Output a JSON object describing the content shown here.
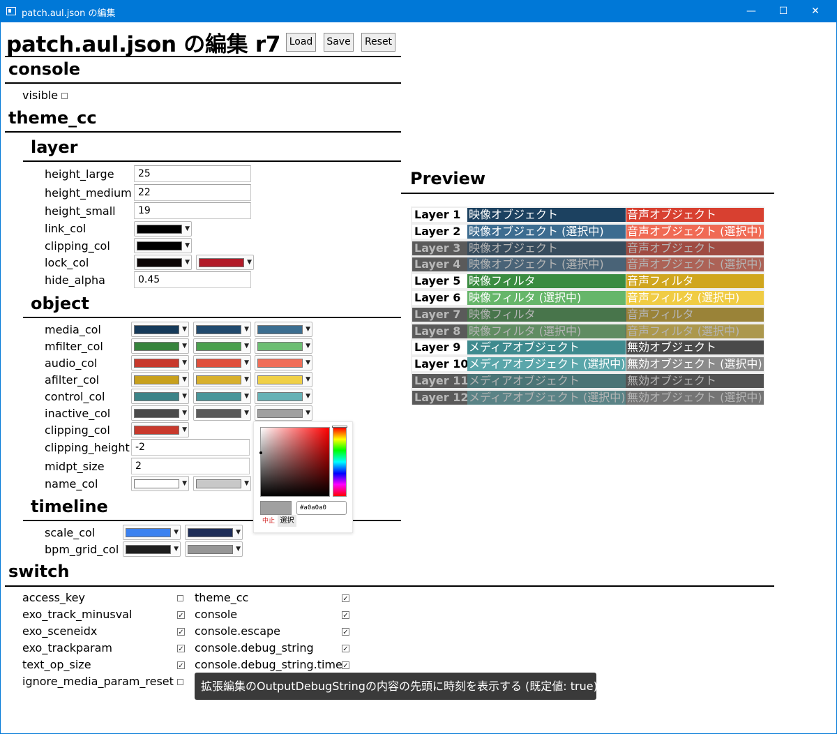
{
  "window": {
    "title": "patch.aul.json の編集",
    "min": "—",
    "max": "☐",
    "close": "✕"
  },
  "header": {
    "title": "patch.aul.json の編集 r7",
    "load": "Load",
    "save": "Save",
    "reset": "Reset"
  },
  "console": {
    "heading": "console",
    "visible_label": "visible",
    "visible_checked": false
  },
  "theme_cc": {
    "heading": "theme_cc",
    "layer": {
      "heading": "layer",
      "height_large": {
        "label": "height_large",
        "value": "25"
      },
      "height_medium": {
        "label": "height_medium",
        "value": "22"
      },
      "height_small": {
        "label": "height_small",
        "value": "19"
      },
      "link_col": {
        "label": "link_col",
        "colors": [
          "#000000"
        ]
      },
      "clipping_col": {
        "label": "clipping_col",
        "colors": [
          "#000000"
        ]
      },
      "lock_col": {
        "label": "lock_col",
        "colors": [
          "#0c0505",
          "#b21a28"
        ]
      },
      "hide_alpha": {
        "label": "hide_alpha",
        "value": "0.45"
      }
    },
    "object": {
      "heading": "object",
      "media_col": {
        "label": "media_col",
        "colors": [
          "#163a5a",
          "#214a6e",
          "#3c6e90"
        ]
      },
      "mfilter_col": {
        "label": "mfilter_col",
        "colors": [
          "#36843c",
          "#4aa04e",
          "#6cbe72"
        ]
      },
      "audio_col": {
        "label": "audio_col",
        "colors": [
          "#c8392c",
          "#e0503c",
          "#f06e58"
        ]
      },
      "afilter_col": {
        "label": "afilter_col",
        "colors": [
          "#c8a01c",
          "#d8b02c",
          "#f0d046"
        ]
      },
      "control_col": {
        "label": "control_col",
        "colors": [
          "#3c8488",
          "#48969a",
          "#66b2b6"
        ]
      },
      "inactive_col": {
        "label": "inactive_col",
        "colors": [
          "#4a4a4a",
          "#5a5a5a",
          "#a0a0a0"
        ]
      },
      "clipping_col": {
        "label": "clipping_col",
        "colors": [
          "#c8392c"
        ]
      },
      "clipping_height": {
        "label": "clipping_height",
        "value": "-2"
      },
      "midpt_size": {
        "label": "midpt_size",
        "value": "2"
      },
      "name_col": {
        "label": "name_col",
        "colors": [
          "#ffffff",
          "#c8c8c8"
        ]
      }
    },
    "timeline": {
      "heading": "timeline",
      "scale_col": {
        "label": "scale_col",
        "colors": [
          "#3c82f0",
          "#1e2d58"
        ]
      },
      "bpm_grid_col": {
        "label": "bpm_grid_col",
        "colors": [
          "#1e1e1e",
          "#969696"
        ]
      }
    }
  },
  "preview": {
    "heading": "Preview",
    "rows": [
      {
        "layer": "Layer 1",
        "left": "映像オブジェクト",
        "right": "音声オブジェクト",
        "lay_bg": "#ffffff",
        "lay_fg": "#000000",
        "left_bg": "#1c4160",
        "right_bg": "#d84030",
        "dim": false
      },
      {
        "layer": "Layer 2",
        "left": "映像オブジェクト (選択中)",
        "right": "音声オブジェクト (選択中)",
        "lay_bg": "#ffffff",
        "lay_fg": "#000000",
        "left_bg": "#3c6c90",
        "right_bg": "#f06a54",
        "dim": false
      },
      {
        "layer": "Layer 3",
        "left": "映像オブジェクト",
        "right": "音声オブジェクト",
        "lay_bg": "#5a5a5a",
        "lay_fg": "#b8b8b8",
        "left_bg": "#1c4160",
        "right_bg": "#d84030",
        "dim": true
      },
      {
        "layer": "Layer 4",
        "left": "映像オブジェクト (選択中)",
        "right": "音声オブジェクト (選択中)",
        "lay_bg": "#5a5a5a",
        "lay_fg": "#b8b8b8",
        "left_bg": "#3c6c90",
        "right_bg": "#f06a54",
        "dim": true
      },
      {
        "layer": "Layer 5",
        "left": "映像フィルタ",
        "right": "音声フィルタ",
        "lay_bg": "#ffffff",
        "lay_fg": "#000000",
        "left_bg": "#3a8c40",
        "right_bg": "#d0a61e",
        "dim": false
      },
      {
        "layer": "Layer 6",
        "left": "映像フィルタ (選択中)",
        "right": "音声フィルタ (選択中)",
        "lay_bg": "#ffffff",
        "lay_fg": "#000000",
        "left_bg": "#66b66a",
        "right_bg": "#f0cc44",
        "dim": false
      },
      {
        "layer": "Layer 7",
        "left": "映像フィルタ",
        "right": "音声フィルタ",
        "lay_bg": "#5a5a5a",
        "lay_fg": "#b8b8b8",
        "left_bg": "#3a8c40",
        "right_bg": "#d0a61e",
        "dim": true
      },
      {
        "layer": "Layer 8",
        "left": "映像フィルタ (選択中)",
        "right": "音声フィルタ (選択中)",
        "lay_bg": "#5a5a5a",
        "lay_fg": "#b8b8b8",
        "left_bg": "#66b66a",
        "right_bg": "#f0cc44",
        "dim": true
      },
      {
        "layer": "Layer 9",
        "left": "メディアオブジェクト",
        "right": "無効オブジェクト",
        "lay_bg": "#ffffff",
        "lay_fg": "#000000",
        "left_bg": "#3e8a8e",
        "right_bg": "#4a4a4a",
        "dim": false
      },
      {
        "layer": "Layer 10",
        "left": "メディアオブジェクト (選択中)",
        "right": "無効オブジェクト (選択中)",
        "lay_bg": "#ffffff",
        "lay_fg": "#000000",
        "left_bg": "#5aa6aa",
        "right_bg": "#8a8a8a",
        "dim": false
      },
      {
        "layer": "Layer 11",
        "left": "メディアオブジェクト",
        "right": "無効オブジェクト",
        "lay_bg": "#5a5a5a",
        "lay_fg": "#b8b8b8",
        "left_bg": "#3e8a8e",
        "right_bg": "#4a4a4a",
        "dim": true
      },
      {
        "layer": "Layer 12",
        "left": "メディアオブジェクト (選択中)",
        "right": "無効オブジェクト (選択中)",
        "lay_bg": "#5a5a5a",
        "lay_fg": "#b8b8b8",
        "left_bg": "#5aa6aa",
        "right_bg": "#8a8a8a",
        "dim": true
      }
    ]
  },
  "color_popup": {
    "hex_value": "#a0a0a0",
    "cancel_label": "中止",
    "select_label": "選択",
    "current_color": "#a0a0a0"
  },
  "switch": {
    "heading": "switch",
    "left": [
      {
        "label": "access_key",
        "checked": false
      },
      {
        "label": "exo_track_minusval",
        "checked": true
      },
      {
        "label": "exo_sceneidx",
        "checked": true
      },
      {
        "label": "exo_trackparam",
        "checked": true
      },
      {
        "label": "text_op_size",
        "checked": true
      },
      {
        "label": "ignore_media_param_reset",
        "checked": false
      }
    ],
    "right": [
      {
        "label": "theme_cc",
        "checked": true
      },
      {
        "label": "console",
        "checked": true
      },
      {
        "label": "console.escape",
        "checked": true
      },
      {
        "label": "console.debug_string",
        "checked": true
      },
      {
        "label": "console.debug_string.time",
        "checked": true
      }
    ]
  },
  "tooltip": "拡張編集のOutputDebugStringの内容の先頭に時刻を表示する (既定値: true)"
}
